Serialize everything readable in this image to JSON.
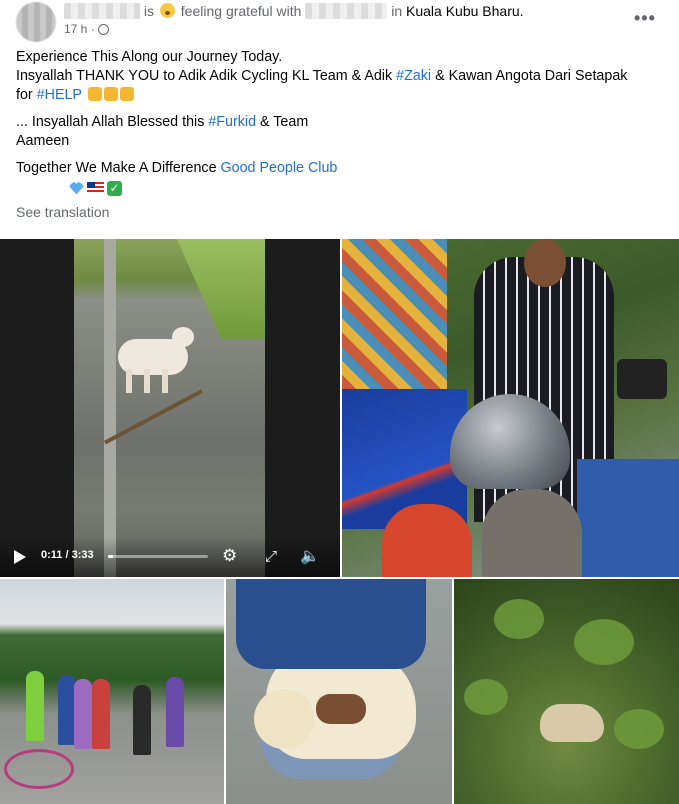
{
  "post": {
    "emoji_label": "is",
    "feeling_text": "feeling grateful with",
    "location_prefix": "in",
    "location": "Kuala Kubu Bharu.",
    "time": "17 h ·",
    "more_icon": "more-horizontal-icon",
    "lines": [
      "Experience This Along our Journey Today.",
      "Insyallah THANK YOU to Adik Adik Cycling KL Team  & Adik",
      "... Insyallah Allah Blessed this",
      "Aameen",
      "Together We Make A Difference"
    ],
    "hashtags": {
      "zaki": "#Zaki",
      "help": "#HELP",
      "furkid": "#Furkid"
    },
    "line2_tail": "& Kawan Angota Dari Setapak",
    "line3_prefix": "for",
    "line4_tail": "& Team",
    "good_people_link": "Good People Club",
    "see_translation": "See translation"
  },
  "video": {
    "time": "0:11 / 3:33",
    "progress_fraction": 0.05
  },
  "colors": {
    "link": "#216fdb",
    "secondary_text": "#65676b"
  }
}
